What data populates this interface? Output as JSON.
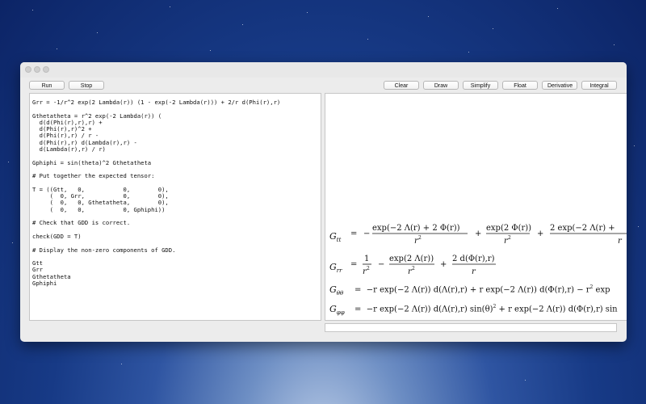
{
  "toolbar": {
    "run": "Run",
    "stop": "Stop",
    "clear": "Clear",
    "draw": "Draw",
    "simplify": "Simplify",
    "float": "Float",
    "derivative": "Derivative",
    "integral": "Integral"
  },
  "editor": {
    "code": "Grr = -1/r^2 exp(2 Lambda(r)) (1 - exp(-2 Lambda(r))) + 2/r d(Phi(r),r)\n\nGthetatheta = r^2 exp(-2 Lambda(r)) (\n  d(d(Phi(r),r),r) +\n  d(Phi(r),r)^2 +\n  d(Phi(r),r) / r -\n  d(Phi(r),r) d(Lambda(r),r) -\n  d(Lambda(r),r) / r)\n\nGphiphi = sin(theta)^2 Gthetatheta\n\n# Put together the expected tensor:\n\nT = ((Gtt,   0,           0,        0),\n     (  0, Grr,           0,        0),\n     (  0,   0, Gthetatheta,        0),\n     (  0,   0,           0, Gphiphi))\n\n# Check that GDD is correct.\n\ncheck(GDD = T)\n\n# Display the non-zero components of GDD.\n\nGtt\nGrr\nGthetatheta\nGphiphi"
  },
  "output": {
    "symbols": {
      "G": "G",
      "equals": "=",
      "minus": "−",
      "plus": "+",
      "r": "r",
      "two": "2",
      "sq": "2",
      "one": "1",
      "tt": "tt",
      "rr": "rr",
      "thth": "θθ",
      "phph": "φφ",
      "exp_m2L_p2P": "exp(−2 Λ(r)  +  2 Φ(r))",
      "exp_2P": "exp(2 Φ(r))",
      "two_exp_m2L_tail": "2 exp(−2 Λ(r)  +",
      "exp_2L": "exp(2 Λ(r))",
      "two_dPhi": "2 d(Φ(r),r)",
      "th_row": "−r exp(−2 Λ(r)) d(Λ(r),r)  +  r exp(−2 Λ(r)) d(Φ(r),r)  −  r",
      "th_tail": " exp",
      "ph_row_a": "−r exp(−2 Λ(r)) d(Λ(r),r) sin(θ)",
      "ph_row_b": "  +  r exp(−2 Λ(r)) d(Φ(r),r) sin"
    }
  }
}
